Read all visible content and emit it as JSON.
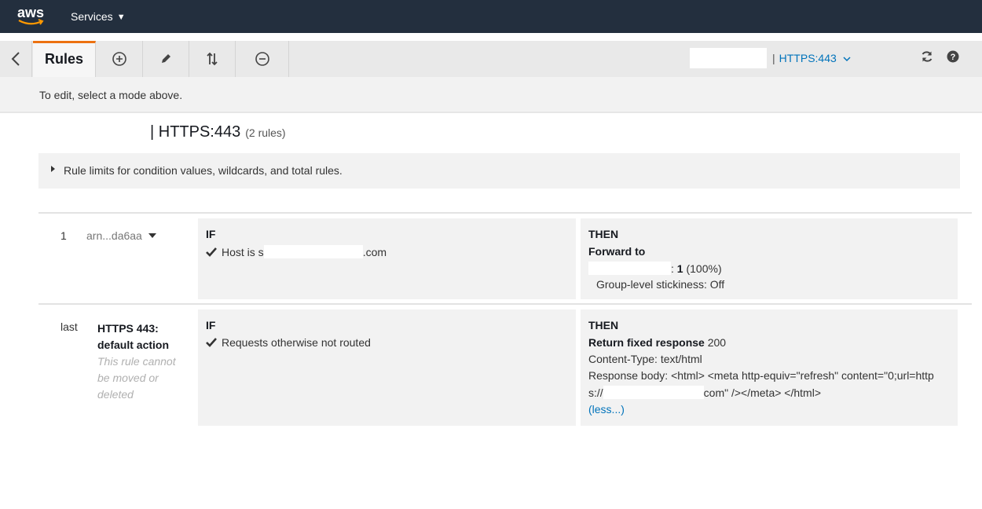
{
  "nav": {
    "logo_text": "aws",
    "services_label": "Services"
  },
  "toolbar": {
    "rules_tab": "Rules",
    "listener": "HTTPS:443",
    "listener_sep": "|"
  },
  "hint": "To edit, select a mode above.",
  "heading": {
    "title": "| HTTPS:443",
    "count": "(2 rules)"
  },
  "limits": {
    "text": "Rule limits for condition values, wildcards, and total rules."
  },
  "rules": [
    {
      "number": "1",
      "arn": "arn...da6aa",
      "if_label": "IF",
      "condition_prefix": "Host is s",
      "condition_suffix": ".com",
      "then_label": "THEN",
      "action": "Forward to",
      "target_sep": ":",
      "target_weight": "1",
      "target_percent": "(100%)",
      "stickiness": "Group-level stickiness: Off"
    },
    {
      "number": "last",
      "title": "HTTPS 443: default action",
      "note": "This rule cannot be moved or deleted",
      "if_label": "IF",
      "condition": "Requests otherwise not routed",
      "then_label": "THEN",
      "action": "Return fixed response",
      "status": "200",
      "content_type": "Content-Type: text/html",
      "body_line1": "Response body: <html> <meta http-equiv=\"refresh\" content=\"0;url=http",
      "body_line2_prefix": "s://",
      "body_line2_suffix": "com\" /></meta> </html>",
      "less": "(less...)"
    }
  ],
  "icons": [
    "back-icon",
    "add-icon",
    "edit-icon",
    "reorder-icon",
    "remove-icon",
    "refresh-icon",
    "help-icon",
    "checkmark-icon"
  ],
  "colors": {
    "nav_bg": "#232f3e",
    "accent": "#ec7211",
    "link": "#0073bb"
  }
}
